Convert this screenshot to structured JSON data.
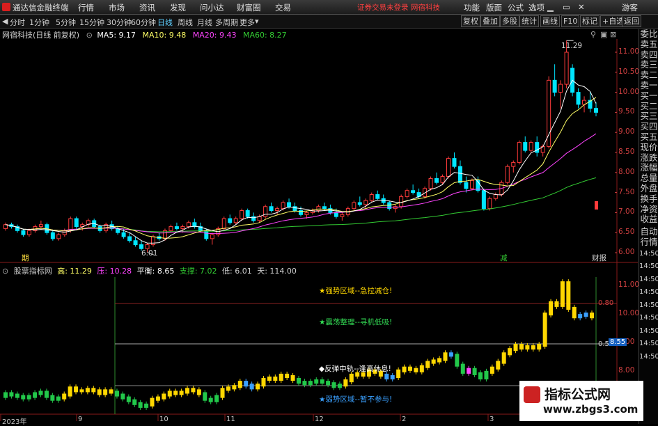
{
  "menu": {
    "app_title": "通达信金融终端",
    "items": [
      "行情",
      "市场",
      "资讯",
      "发现",
      "问小达",
      "财富圈",
      "交易"
    ],
    "notice": "证券交易未登录  网宿科技",
    "right_items": [
      "功能",
      "版面",
      "公式",
      "选项"
    ],
    "guest": "游客"
  },
  "toolbar": {
    "periods": [
      "分时",
      "1分钟",
      "5分钟",
      "15分钟",
      "30分钟",
      "60分钟",
      "日线",
      "周线",
      "月线",
      "多周期",
      "更多"
    ],
    "selected": "日线",
    "right_buttons": [
      "复权",
      "叠加",
      "多股",
      "统计",
      "画线",
      "F10",
      "标记",
      "+自选",
      "返回"
    ]
  },
  "price_info": {
    "stock": "网宿科技(日线 前复权)",
    "ma5": "MA5: 9.17",
    "ma10": "MA10: 9.48",
    "ma20": "MA20: 9.43",
    "ma60": "MA60: 8.27"
  },
  "price_axis": [
    "11.00",
    "10.50",
    "10.00",
    "9.50",
    "9.00",
    "8.50",
    "8.00",
    "7.50",
    "7.00",
    "6.50",
    "6.00"
  ],
  "price_annotations": {
    "high": "11.29",
    "low": "6.01",
    "label_left": "期",
    "label_mid": "减",
    "label_right": "财报"
  },
  "indicator_info": {
    "name": "股票指标网",
    "high": "高: 11.29",
    "pressure": "压: 10.28",
    "balance": "平衡: 8.65",
    "support": "支撑: 7.02",
    "low": "低: 6.01",
    "days": "天: 114.00"
  },
  "indicator_axis": [
    "11.00",
    "10.00",
    "9.00",
    "8.00"
  ],
  "indicator_levels": {
    "upper": "0.80",
    "mid": "0.50",
    "current": "8.55"
  },
  "indicator_annotations": {
    "strong": "★强势区域--急拉减仓!",
    "shock": "★震荡整理--寻机低吸!",
    "rebound": "◆反弹中轨--逢高休息!",
    "weak": "★弱势区域--暂不参与!"
  },
  "x_axis": [
    "2023年",
    "9",
    "10",
    "11",
    "12",
    "2",
    "3"
  ],
  "right_panel": [
    "委比",
    "卖五",
    "卖四",
    "卖三",
    "卖二",
    "卖一",
    "买一",
    "买二",
    "买三",
    "买四",
    "买五",
    "现价",
    "涨跌",
    "涨幅",
    "总量",
    "外盘",
    "换手",
    "净资",
    "收益",
    "自动",
    "行情"
  ],
  "right_panel_times": [
    "14:50",
    "14:50",
    "14:50",
    "14:50",
    "14:50",
    "14:50",
    "14:50",
    "14:50",
    "14:50"
  ],
  "watermark": {
    "title": "指标公式网",
    "url": "www.zbgs3.com"
  },
  "colors": {
    "up": "#ff3b3b",
    "down": "#00e5ff",
    "ma5": "#ffffff",
    "ma10": "#ffff66",
    "ma20": "#ff44ff",
    "ma60": "#33cc33",
    "ind_strong": "#ffd700",
    "ind_blue": "#3aa0ff",
    "ind_green": "#22c84a"
  },
  "candles": [
    [
      6.6,
      6.75,
      6.55,
      6.7
    ],
    [
      6.7,
      6.75,
      6.6,
      6.65
    ],
    [
      6.65,
      6.7,
      6.5,
      6.55
    ],
    [
      6.55,
      6.6,
      6.4,
      6.45
    ],
    [
      6.45,
      6.6,
      6.4,
      6.55
    ],
    [
      6.55,
      6.7,
      6.5,
      6.65
    ],
    [
      6.65,
      6.8,
      6.6,
      6.7
    ],
    [
      6.7,
      6.75,
      6.45,
      6.5
    ],
    [
      6.5,
      6.55,
      6.3,
      6.35
    ],
    [
      6.35,
      6.5,
      6.3,
      6.45
    ],
    [
      6.45,
      6.6,
      6.4,
      6.55
    ],
    [
      6.55,
      6.9,
      6.5,
      6.85
    ],
    [
      6.85,
      6.9,
      6.6,
      6.65
    ],
    [
      6.65,
      6.75,
      6.55,
      6.7
    ],
    [
      6.7,
      6.85,
      6.65,
      6.8
    ],
    [
      6.8,
      6.85,
      6.6,
      6.65
    ],
    [
      6.65,
      6.7,
      6.5,
      6.55
    ],
    [
      6.55,
      6.75,
      6.5,
      6.7
    ],
    [
      6.7,
      6.8,
      6.55,
      6.6
    ],
    [
      6.6,
      6.65,
      6.45,
      6.5
    ],
    [
      6.5,
      6.6,
      6.35,
      6.4
    ],
    [
      6.4,
      6.5,
      6.25,
      6.3
    ],
    [
      6.3,
      6.4,
      6.15,
      6.2
    ],
    [
      6.2,
      6.3,
      6.05,
      6.1
    ],
    [
      6.1,
      6.25,
      6.01,
      6.2
    ],
    [
      6.2,
      6.45,
      6.15,
      6.4
    ],
    [
      6.4,
      6.5,
      6.3,
      6.35
    ],
    [
      6.35,
      6.6,
      6.3,
      6.55
    ],
    [
      6.55,
      6.7,
      6.5,
      6.65
    ],
    [
      6.65,
      6.75,
      6.55,
      6.6
    ],
    [
      6.6,
      6.7,
      6.5,
      6.65
    ],
    [
      6.65,
      6.8,
      6.6,
      6.75
    ],
    [
      6.75,
      6.85,
      6.6,
      6.65
    ],
    [
      6.65,
      6.75,
      6.5,
      6.55
    ],
    [
      6.55,
      6.6,
      6.3,
      6.35
    ],
    [
      6.35,
      6.5,
      6.2,
      6.45
    ],
    [
      6.45,
      6.65,
      6.4,
      6.6
    ],
    [
      6.6,
      6.9,
      6.55,
      6.85
    ],
    [
      6.85,
      6.95,
      6.7,
      6.75
    ],
    [
      6.75,
      6.9,
      6.7,
      6.85
    ],
    [
      6.85,
      7.1,
      6.8,
      7.05
    ],
    [
      7.05,
      7.1,
      6.85,
      6.9
    ],
    [
      6.9,
      7.0,
      6.75,
      6.8
    ],
    [
      6.8,
      6.95,
      6.75,
      6.9
    ],
    [
      6.9,
      7.2,
      6.85,
      7.15
    ],
    [
      7.15,
      7.25,
      7.0,
      7.05
    ],
    [
      7.05,
      7.15,
      6.95,
      7.1
    ],
    [
      7.1,
      7.3,
      7.05,
      7.25
    ],
    [
      7.25,
      7.35,
      7.1,
      7.15
    ],
    [
      7.15,
      7.25,
      7.0,
      7.05
    ],
    [
      7.05,
      7.15,
      6.9,
      6.95
    ],
    [
      6.95,
      7.05,
      6.85,
      7.0
    ],
    [
      7.0,
      7.1,
      6.95,
      7.05
    ],
    [
      7.05,
      7.2,
      7.0,
      7.15
    ],
    [
      7.15,
      7.25,
      7.05,
      7.1
    ],
    [
      7.1,
      7.2,
      6.95,
      7.0
    ],
    [
      7.0,
      7.1,
      6.85,
      6.9
    ],
    [
      6.9,
      7.0,
      6.8,
      6.95
    ],
    [
      6.95,
      7.15,
      6.9,
      7.1
    ],
    [
      7.1,
      7.3,
      7.05,
      7.25
    ],
    [
      7.25,
      7.4,
      7.15,
      7.2
    ],
    [
      7.2,
      7.35,
      7.1,
      7.3
    ],
    [
      7.3,
      7.5,
      7.25,
      7.45
    ],
    [
      7.45,
      7.55,
      7.3,
      7.35
    ],
    [
      7.35,
      7.45,
      7.2,
      7.25
    ],
    [
      7.25,
      7.3,
      7.05,
      7.1
    ],
    [
      7.1,
      7.2,
      7.0,
      7.15
    ],
    [
      7.15,
      7.45,
      7.1,
      7.4
    ],
    [
      7.4,
      7.6,
      7.35,
      7.55
    ],
    [
      7.55,
      7.7,
      7.45,
      7.5
    ],
    [
      7.5,
      7.6,
      7.35,
      7.4
    ],
    [
      7.4,
      7.65,
      7.35,
      7.6
    ],
    [
      7.6,
      7.9,
      7.55,
      7.85
    ],
    [
      7.85,
      8.0,
      7.7,
      7.75
    ],
    [
      7.75,
      7.95,
      7.7,
      7.9
    ],
    [
      7.9,
      8.4,
      7.85,
      8.35
    ],
    [
      8.35,
      8.5,
      8.1,
      8.15
    ],
    [
      8.15,
      8.3,
      7.7,
      7.75
    ],
    [
      7.75,
      7.9,
      7.5,
      7.6
    ],
    [
      7.6,
      7.85,
      7.55,
      7.8
    ],
    [
      7.8,
      7.9,
      7.5,
      7.55
    ],
    [
      7.55,
      7.6,
      7.05,
      7.1
    ],
    [
      7.1,
      7.4,
      7.05,
      7.35
    ],
    [
      7.35,
      7.5,
      7.3,
      7.45
    ],
    [
      7.45,
      7.8,
      7.4,
      7.75
    ],
    [
      7.75,
      8.2,
      7.7,
      8.15
    ],
    [
      8.15,
      8.3,
      8.0,
      8.25
    ],
    [
      8.25,
      8.8,
      8.2,
      8.75
    ],
    [
      8.75,
      8.9,
      8.5,
      8.55
    ],
    [
      8.55,
      8.8,
      8.5,
      8.75
    ],
    [
      8.75,
      8.9,
      8.4,
      8.5
    ],
    [
      8.5,
      8.7,
      8.4,
      8.65
    ],
    [
      8.65,
      10.4,
      8.6,
      10.3
    ],
    [
      10.3,
      10.7,
      9.9,
      10.0
    ],
    [
      10.0,
      10.3,
      9.6,
      10.2
    ],
    [
      10.2,
      11.29,
      10.1,
      11.0
    ],
    [
      10.6,
      10.7,
      9.9,
      10.0
    ],
    [
      10.0,
      10.1,
      9.6,
      9.7
    ],
    [
      9.7,
      9.9,
      9.5,
      9.8
    ],
    [
      9.8,
      10.0,
      9.5,
      9.6
    ],
    [
      9.6,
      9.75,
      9.4,
      9.5
    ]
  ],
  "indicator_bars": [
    [
      7.2,
      "g"
    ],
    [
      7.15,
      "g"
    ],
    [
      7.1,
      "g"
    ],
    [
      7.05,
      "g"
    ],
    [
      7.1,
      "g"
    ],
    [
      7.2,
      "g"
    ],
    [
      7.25,
      "g"
    ],
    [
      7.1,
      "g"
    ],
    [
      7.0,
      "g"
    ],
    [
      7.05,
      "g"
    ],
    [
      7.15,
      "y"
    ],
    [
      7.4,
      "y"
    ],
    [
      7.3,
      "y"
    ],
    [
      7.3,
      "y"
    ],
    [
      7.35,
      "y"
    ],
    [
      7.3,
      "y"
    ],
    [
      7.2,
      "y"
    ],
    [
      7.3,
      "y"
    ],
    [
      7.25,
      "y"
    ],
    [
      7.15,
      "g"
    ],
    [
      7.05,
      "g"
    ],
    [
      6.95,
      "g"
    ],
    [
      6.85,
      "g"
    ],
    [
      6.75,
      "g"
    ],
    [
      6.8,
      "g"
    ],
    [
      7.0,
      "y"
    ],
    [
      7.05,
      "y"
    ],
    [
      7.15,
      "y"
    ],
    [
      7.25,
      "y"
    ],
    [
      7.2,
      "y"
    ],
    [
      7.25,
      "y"
    ],
    [
      7.35,
      "y"
    ],
    [
      7.3,
      "y"
    ],
    [
      7.2,
      "y"
    ],
    [
      7.0,
      "g"
    ],
    [
      6.95,
      "g"
    ],
    [
      7.1,
      "g"
    ],
    [
      7.35,
      "y"
    ],
    [
      7.4,
      "y"
    ],
    [
      7.45,
      "y"
    ],
    [
      7.6,
      "y"
    ],
    [
      7.5,
      "b"
    ],
    [
      7.4,
      "b"
    ],
    [
      7.5,
      "y"
    ],
    [
      7.7,
      "y"
    ],
    [
      7.75,
      "y"
    ],
    [
      7.7,
      "y"
    ],
    [
      7.85,
      "y"
    ],
    [
      7.8,
      "y"
    ],
    [
      7.7,
      "y"
    ],
    [
      7.6,
      "g"
    ],
    [
      7.55,
      "g"
    ],
    [
      7.6,
      "g"
    ],
    [
      7.65,
      "g"
    ],
    [
      7.6,
      "g"
    ],
    [
      7.55,
      "g"
    ],
    [
      7.45,
      "g"
    ],
    [
      7.5,
      "g"
    ],
    [
      7.65,
      "y"
    ],
    [
      7.85,
      "y"
    ],
    [
      7.9,
      "y"
    ],
    [
      7.85,
      "y"
    ],
    [
      8.0,
      "y"
    ],
    [
      7.95,
      "y"
    ],
    [
      7.85,
      "y"
    ],
    [
      7.75,
      "b"
    ],
    [
      7.8,
      "b"
    ],
    [
      8.0,
      "y"
    ],
    [
      8.1,
      "y"
    ],
    [
      8.05,
      "y"
    ],
    [
      8.0,
      "y"
    ],
    [
      8.15,
      "y"
    ],
    [
      8.3,
      "y"
    ],
    [
      8.35,
      "y"
    ],
    [
      8.4,
      "y"
    ],
    [
      8.6,
      "y"
    ],
    [
      8.55,
      "b"
    ],
    [
      8.2,
      "g"
    ],
    [
      7.95,
      "g"
    ],
    [
      8.05,
      "p"
    ],
    [
      7.9,
      "g"
    ],
    [
      7.75,
      "g"
    ],
    [
      7.95,
      "g"
    ],
    [
      8.1,
      "y"
    ],
    [
      8.3,
      "y"
    ],
    [
      8.6,
      "y"
    ],
    [
      8.75,
      "y"
    ],
    [
      8.9,
      "y"
    ],
    [
      8.8,
      "y"
    ],
    [
      8.85,
      "y"
    ],
    [
      8.8,
      "y"
    ],
    [
      8.9,
      "y"
    ],
    [
      10.0,
      "y"
    ],
    [
      10.4,
      "y"
    ],
    [
      10.3,
      "y"
    ],
    [
      11.1,
      "y"
    ],
    [
      10.2,
      "y"
    ],
    [
      9.9,
      "y"
    ],
    [
      9.95,
      "b"
    ],
    [
      10.0,
      "b"
    ],
    [
      9.9,
      "y"
    ]
  ]
}
